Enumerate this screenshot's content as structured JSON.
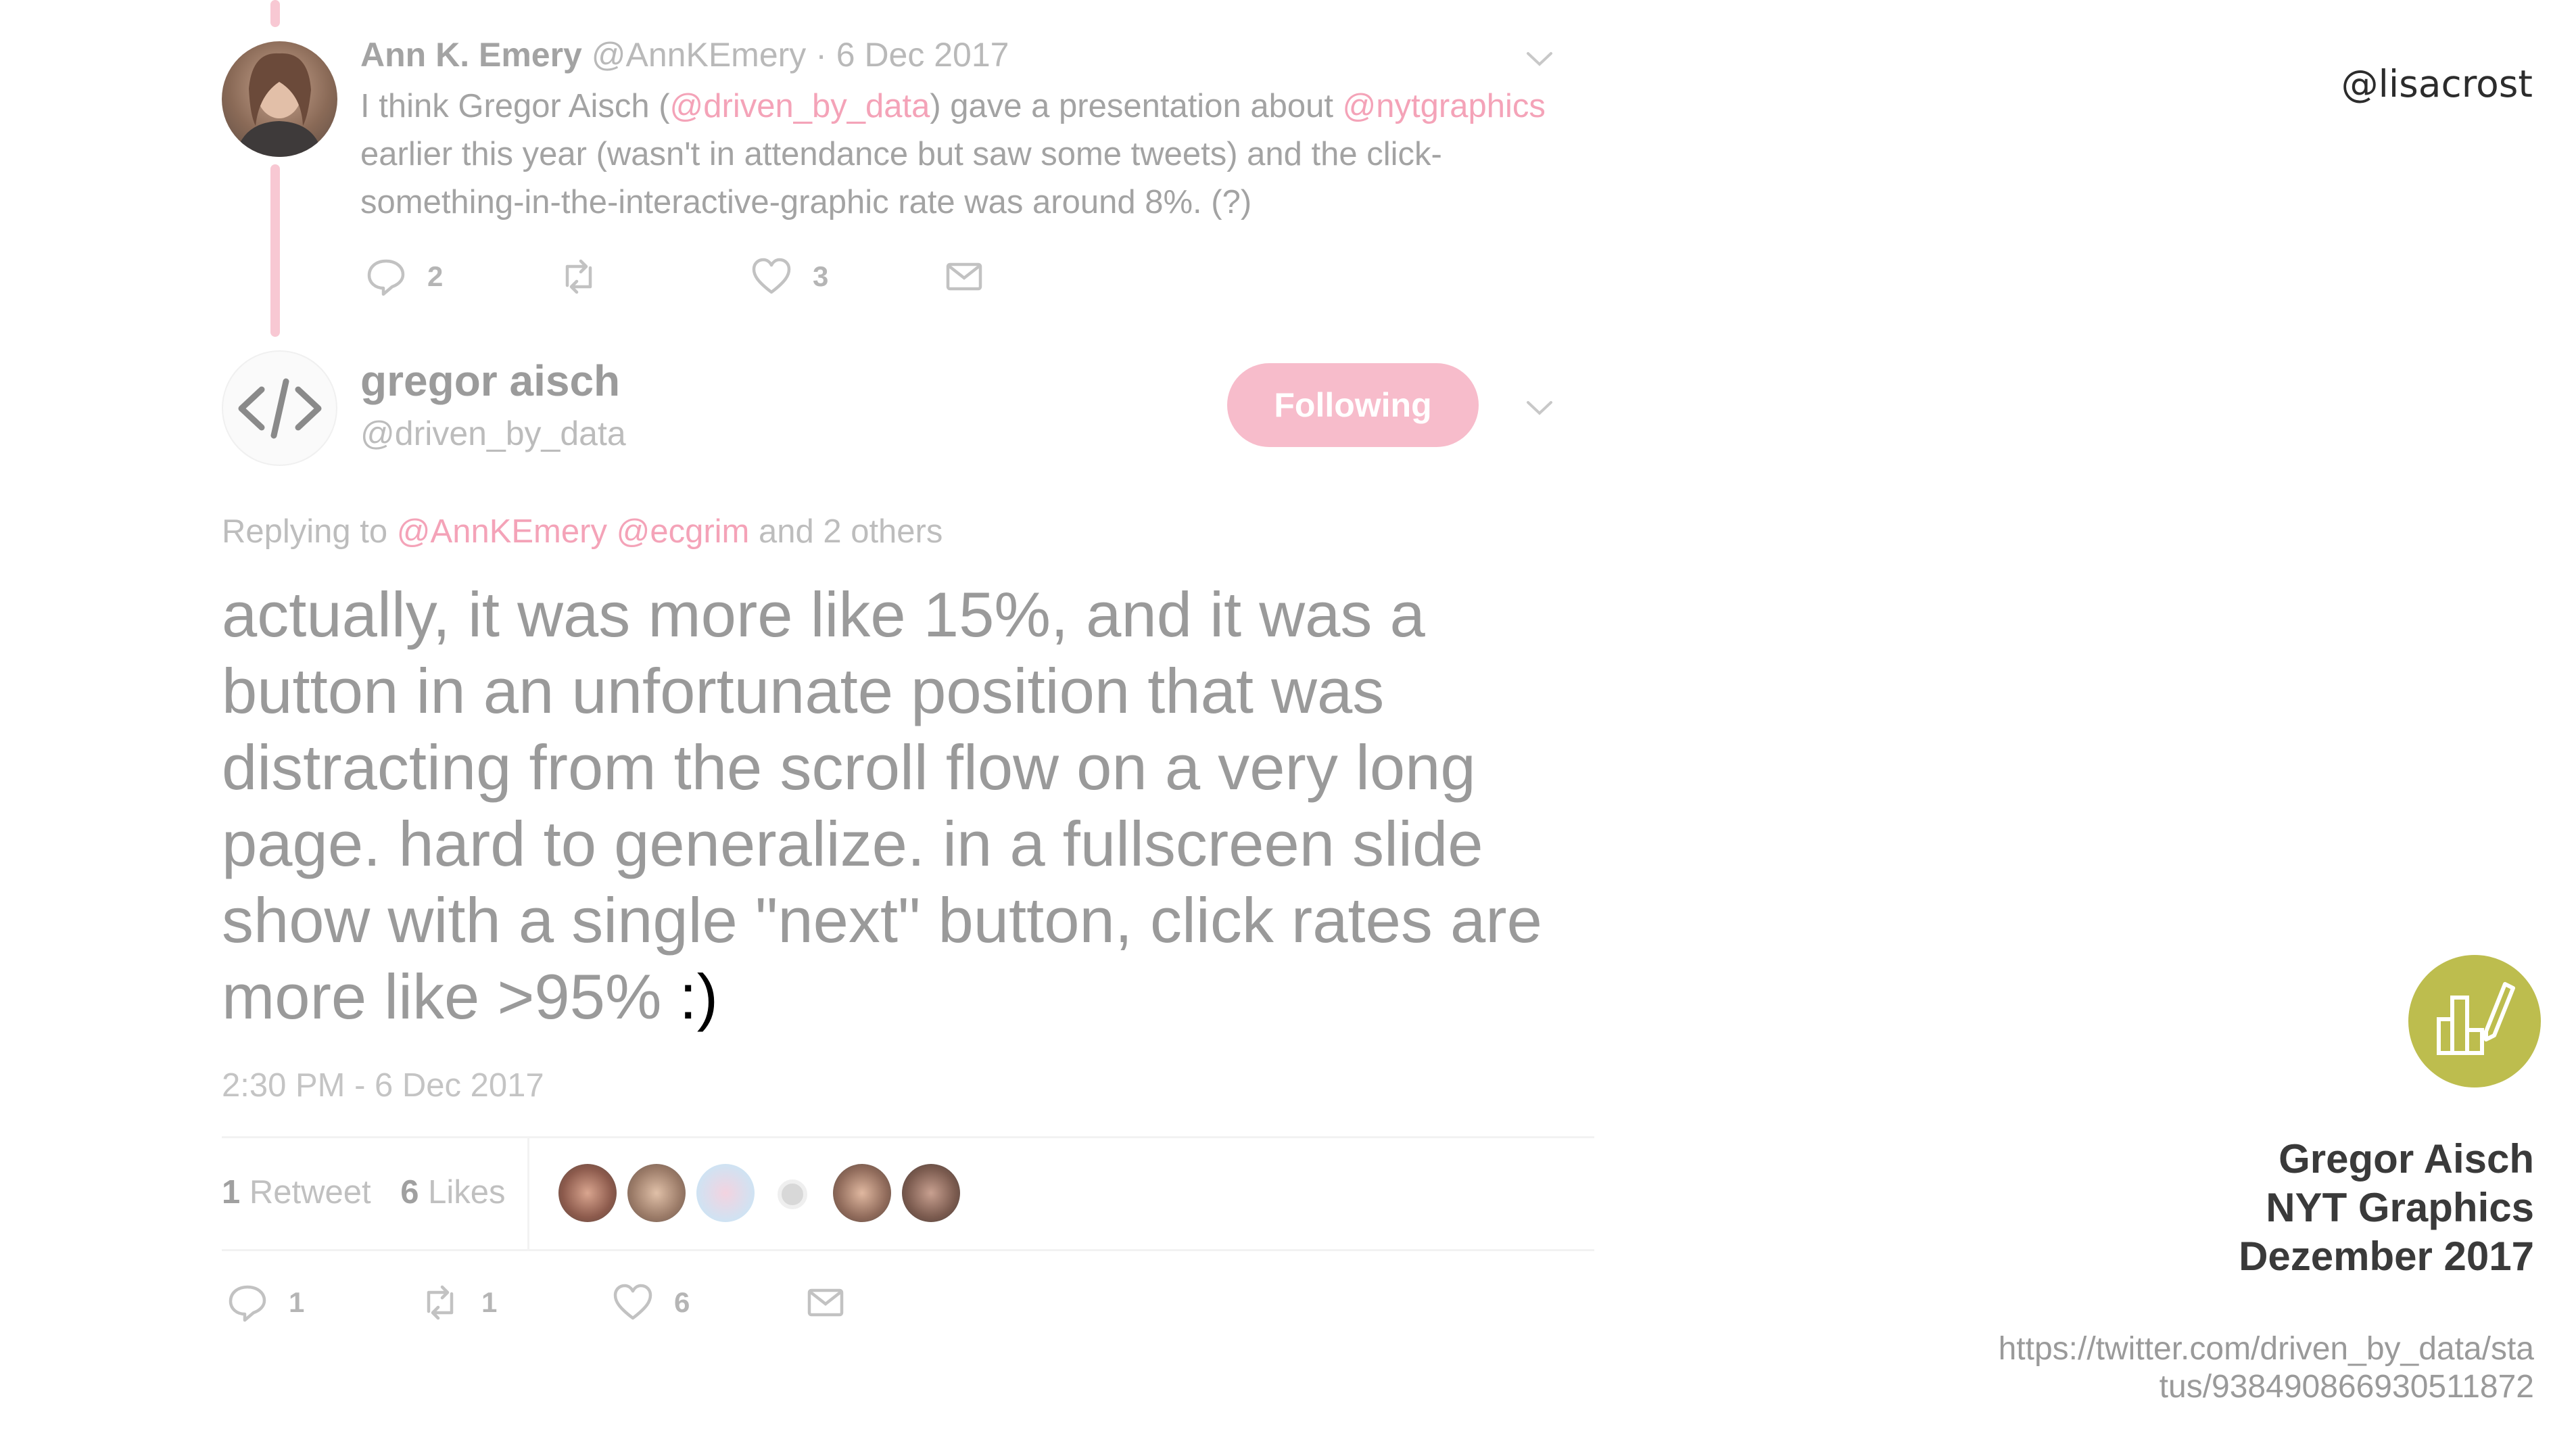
{
  "slide": {
    "presenter_handle": "@lisacrost",
    "credit_lines": [
      "Gregor Aisch",
      "NYT Graphics",
      "Dezember 2017"
    ],
    "source_url": "https://twitter.com/driven_by_data/status/938490866930511872"
  },
  "parent_tweet": {
    "author_name": "Ann K. Emery",
    "author_handle": "@AnnKEmery",
    "date": "· 6 Dec 2017",
    "text_parts": {
      "a": "I think Gregor Aisch (",
      "mention1": "@driven_by_data",
      "b": ") gave a presentation about ",
      "mention2": "@nytgraphics",
      "c": " earlier this year (wasn't in attendance but saw some tweets) and the click-something-in-the-interactive-graphic rate was around 8%. (?)"
    },
    "reply_count": "2",
    "retweet_count": "",
    "like_count": "3"
  },
  "main_tweet": {
    "author_name": "gregor aisch",
    "author_handle": "@driven_by_data",
    "follow_label": "Following",
    "replying_prefix": "Replying to ",
    "replying_to1": "@AnnKEmery",
    "replying_to2": "@ecgrim",
    "replying_suffix": " and 2 others",
    "text": "actually, it was more like 15%, and it was a button in an unfortunate position that was distracting from the scroll flow on a very long page. hard to generalize. in a fullscreen slide show with a single \"next\" button, click rates are more like >95%",
    "emoticon": " :)",
    "timestamp": "2:30 PM - 6 Dec 2017",
    "retweets_count": "1",
    "retweets_label": "Retweet",
    "likes_count": "6",
    "likes_label": "Likes",
    "reply_count": "1",
    "retweet_count": "1",
    "like_count": "6"
  },
  "colors": {
    "accent_pink": "#f4a3b8",
    "logo_green": "#bdbd4e"
  },
  "icons": [
    "reply-icon",
    "retweet-icon",
    "heart-icon",
    "mail-icon",
    "chevron-down-icon",
    "code-icon",
    "chart-pen-logo"
  ]
}
